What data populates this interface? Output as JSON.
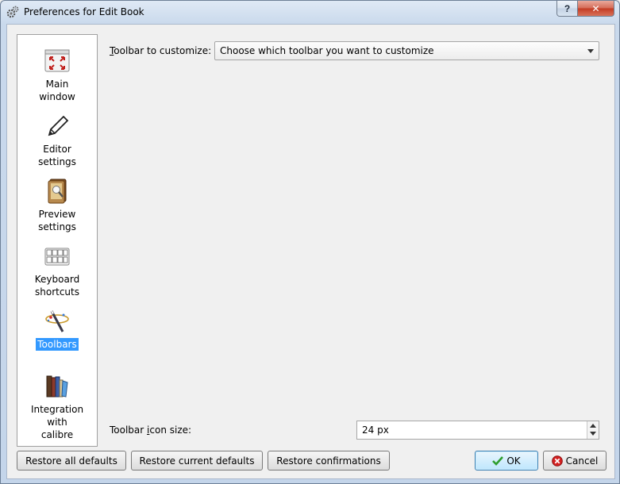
{
  "window": {
    "title": "Preferences for Edit Book",
    "help_label": "?",
    "close_label": "✕"
  },
  "sidebar": {
    "items": [
      {
        "label_line1": "Main",
        "label_line2": "window",
        "icon": "main-window-icon"
      },
      {
        "label_line1": "Editor",
        "label_line2": "settings",
        "icon": "pencil-icon"
      },
      {
        "label_line1": "Preview",
        "label_line2": "settings",
        "icon": "preview-book-icon"
      },
      {
        "label_line1": "Keyboard",
        "label_line2": "shortcuts",
        "icon": "keyboard-icon"
      },
      {
        "label_line1": "Toolbars",
        "label_line2": "",
        "icon": "toolbars-wand-icon",
        "selected": true
      },
      {
        "label_line1": "Integration",
        "label_line2": "with",
        "label_line3": "calibre",
        "icon": "bookshelf-icon"
      }
    ]
  },
  "main": {
    "toolbar_label_first": "T",
    "toolbar_label_rest": "oolbar to customize:",
    "toolbar_combo_value": "Choose which toolbar you want to customize",
    "icon_size_label_first": "Toolbar ",
    "icon_size_label_u": "i",
    "icon_size_label_rest": "con size:",
    "icon_size_value": "24 px"
  },
  "buttons": {
    "restore_all": "Restore all defaults",
    "restore_current": "Restore current defaults",
    "restore_confirmations": "Restore confirmations",
    "ok": "OK",
    "cancel": "Cancel"
  },
  "colors": {
    "selection": "#3399ff",
    "ok_check": "#2e9e2e",
    "cancel_red": "#d42020"
  }
}
